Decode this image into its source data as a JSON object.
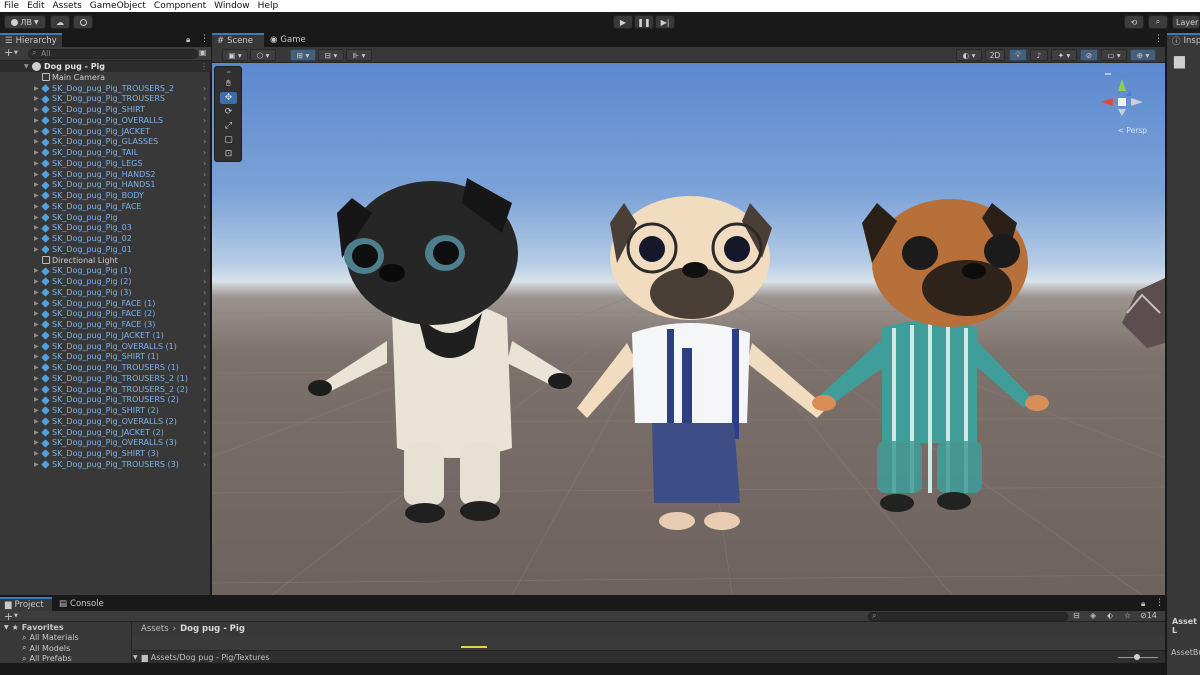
{
  "menu": [
    "File",
    "Edit",
    "Assets",
    "GameObject",
    "Component",
    "Window",
    "Help"
  ],
  "toolbar": {
    "account_label": "ЛВ",
    "layers_label": "Layer"
  },
  "hierarchy": {
    "tab_label": "Hierarchy",
    "search_placeholder": "All",
    "scene_name": "Dog pug - Pig",
    "items": [
      {
        "label": "Main Camera",
        "kind": "plain"
      },
      {
        "label": "SK_Dog_pug_Pig_TROUSERS_2",
        "kind": "prefab"
      },
      {
        "label": "SK_Dog_pug_Pig_TROUSERS",
        "kind": "prefab"
      },
      {
        "label": "SK_Dog_pug_Pig_SHIRT",
        "kind": "prefab"
      },
      {
        "label": "SK_Dog_pug_Pig_OVERALLS",
        "kind": "prefab"
      },
      {
        "label": "SK_Dog_pug_Pig_JACKET",
        "kind": "prefab"
      },
      {
        "label": "SK_Dog_pug_Pig_GLASSES",
        "kind": "prefab"
      },
      {
        "label": "SK_Dog_pug_Pig_TAIL",
        "kind": "prefab"
      },
      {
        "label": "SK_Dog_pug_Pig_LEGS",
        "kind": "prefab"
      },
      {
        "label": "SK_Dog_pug_Pig_HANDS2",
        "kind": "prefab"
      },
      {
        "label": "SK_Dog_pug_Pig_HANDS1",
        "kind": "prefab"
      },
      {
        "label": "SK_Dog_pug_Pig_BODY",
        "kind": "prefab"
      },
      {
        "label": "SK_Dog_pug_Pig_FACE",
        "kind": "prefab"
      },
      {
        "label": "SK_Dog_pug_Pig",
        "kind": "prefab"
      },
      {
        "label": "SK_Dog_pug_Pig_03",
        "kind": "prefab"
      },
      {
        "label": "SK_Dog_pug_Pig_02",
        "kind": "prefab"
      },
      {
        "label": "SK_Dog_pug_Pig_01",
        "kind": "prefab"
      },
      {
        "label": "Directional Light",
        "kind": "plain"
      },
      {
        "label": "SK_Dog_pug_Pig (1)",
        "kind": "prefab"
      },
      {
        "label": "SK_Dog_pug_Pig (2)",
        "kind": "prefab"
      },
      {
        "label": "SK_Dog_pug_Pig (3)",
        "kind": "prefab"
      },
      {
        "label": "SK_Dog_pug_Pig_FACE (1)",
        "kind": "prefab"
      },
      {
        "label": "SK_Dog_pug_Pig_FACE (2)",
        "kind": "prefab"
      },
      {
        "label": "SK_Dog_pug_Pig_FACE (3)",
        "kind": "prefab"
      },
      {
        "label": "SK_Dog_pug_Pig_JACKET (1)",
        "kind": "prefab"
      },
      {
        "label": "SK_Dog_pug_Pig_OVERALLS (1)",
        "kind": "prefab"
      },
      {
        "label": "SK_Dog_pug_Pig_SHIRT (1)",
        "kind": "prefab"
      },
      {
        "label": "SK_Dog_pug_Pig_TROUSERS (1)",
        "kind": "prefab"
      },
      {
        "label": "SK_Dog_pug_Pig_TROUSERS_2 (1)",
        "kind": "prefab"
      },
      {
        "label": "SK_Dog_pug_Pig_TROUSERS_2 (2)",
        "kind": "prefab"
      },
      {
        "label": "SK_Dog_pug_Pig_TROUSERS (2)",
        "kind": "prefab"
      },
      {
        "label": "SK_Dog_pug_Pig_SHIRT (2)",
        "kind": "prefab"
      },
      {
        "label": "SK_Dog_pug_Pig_OVERALLS (2)",
        "kind": "prefab"
      },
      {
        "label": "SK_Dog_pug_Pig_JACKET (2)",
        "kind": "prefab"
      },
      {
        "label": "SK_Dog_pug_Pig_OVERALLS (3)",
        "kind": "prefab"
      },
      {
        "label": "SK_Dog_pug_Pig_SHIRT (3)",
        "kind": "prefab"
      },
      {
        "label": "SK_Dog_pug_Pig_TROUSERS (3)",
        "kind": "prefab"
      }
    ]
  },
  "scene": {
    "tabs": [
      "Scene",
      "Game"
    ],
    "mode_2d_label": "2D",
    "persp_label": "< Persp",
    "characters": [
      {
        "name": "black-pug",
        "fur": "#2a2a2a",
        "outfit": "cream-polka-dot-onesie"
      },
      {
        "name": "fawn-pug-with-glasses",
        "fur": "#e8d2b5",
        "outfit": "shirt-tie-overalls"
      },
      {
        "name": "brown-pug",
        "fur": "#b8703a",
        "outfit": "teal-striped-pajamas"
      }
    ]
  },
  "inspector": {
    "tab_label": "Inspe",
    "asset_label": "Asset L",
    "asset_bundle_label": "AssetBu"
  },
  "project": {
    "tabs": [
      "Project",
      "Console"
    ],
    "favorites_label": "Favorites",
    "favorites": [
      "All Materials",
      "All Models",
      "All Prefabs"
    ],
    "breadcrumb": [
      "Assets",
      "Dog pug - Pig"
    ],
    "path": "Assets/Dog pug - Pig/Textures",
    "hidden_count": "14"
  },
  "colors": {
    "accent": "#3a79bb",
    "prefab_text": "#7bb3f0",
    "panel_bg": "#383838"
  }
}
